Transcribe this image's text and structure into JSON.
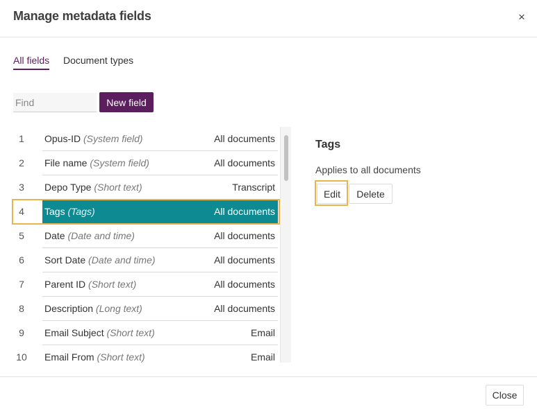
{
  "dialog": {
    "title": "Manage metadata fields",
    "close_icon": "×"
  },
  "tabs": [
    {
      "label": "All fields",
      "active": true
    },
    {
      "label": "Document types",
      "active": false
    }
  ],
  "search": {
    "placeholder": "Find",
    "value": ""
  },
  "toolbar": {
    "new_field_label": "New field"
  },
  "fields": [
    {
      "num": "1",
      "name": "Opus-ID",
      "type": "(System field)",
      "scope": "All documents"
    },
    {
      "num": "2",
      "name": "File name",
      "type": "(System field)",
      "scope": "All documents"
    },
    {
      "num": "3",
      "name": "Depo Type",
      "type": "(Short text)",
      "scope": "Transcript"
    },
    {
      "num": "4",
      "name": "Tags",
      "type": "(Tags)",
      "scope": "All documents"
    },
    {
      "num": "5",
      "name": "Date",
      "type": "(Date and time)",
      "scope": "All documents"
    },
    {
      "num": "6",
      "name": "Sort Date",
      "type": "(Date and time)",
      "scope": "All documents"
    },
    {
      "num": "7",
      "name": "Parent ID",
      "type": "(Short text)",
      "scope": "All documents"
    },
    {
      "num": "8",
      "name": "Description",
      "type": "(Long text)",
      "scope": "All documents"
    },
    {
      "num": "9",
      "name": "Email Subject",
      "type": "(Short text)",
      "scope": "Email"
    },
    {
      "num": "10",
      "name": "Email From",
      "type": "(Short text)",
      "scope": "Email"
    }
  ],
  "selected_index": 3,
  "detail": {
    "title": "Tags",
    "applies": "Applies to all documents",
    "edit_label": "Edit",
    "delete_label": "Delete"
  },
  "footer": {
    "close_label": "Close"
  },
  "colors": {
    "accent": "#5b1f5e",
    "selection": "#0d8a92",
    "highlight_outline": "#e8b54a"
  }
}
